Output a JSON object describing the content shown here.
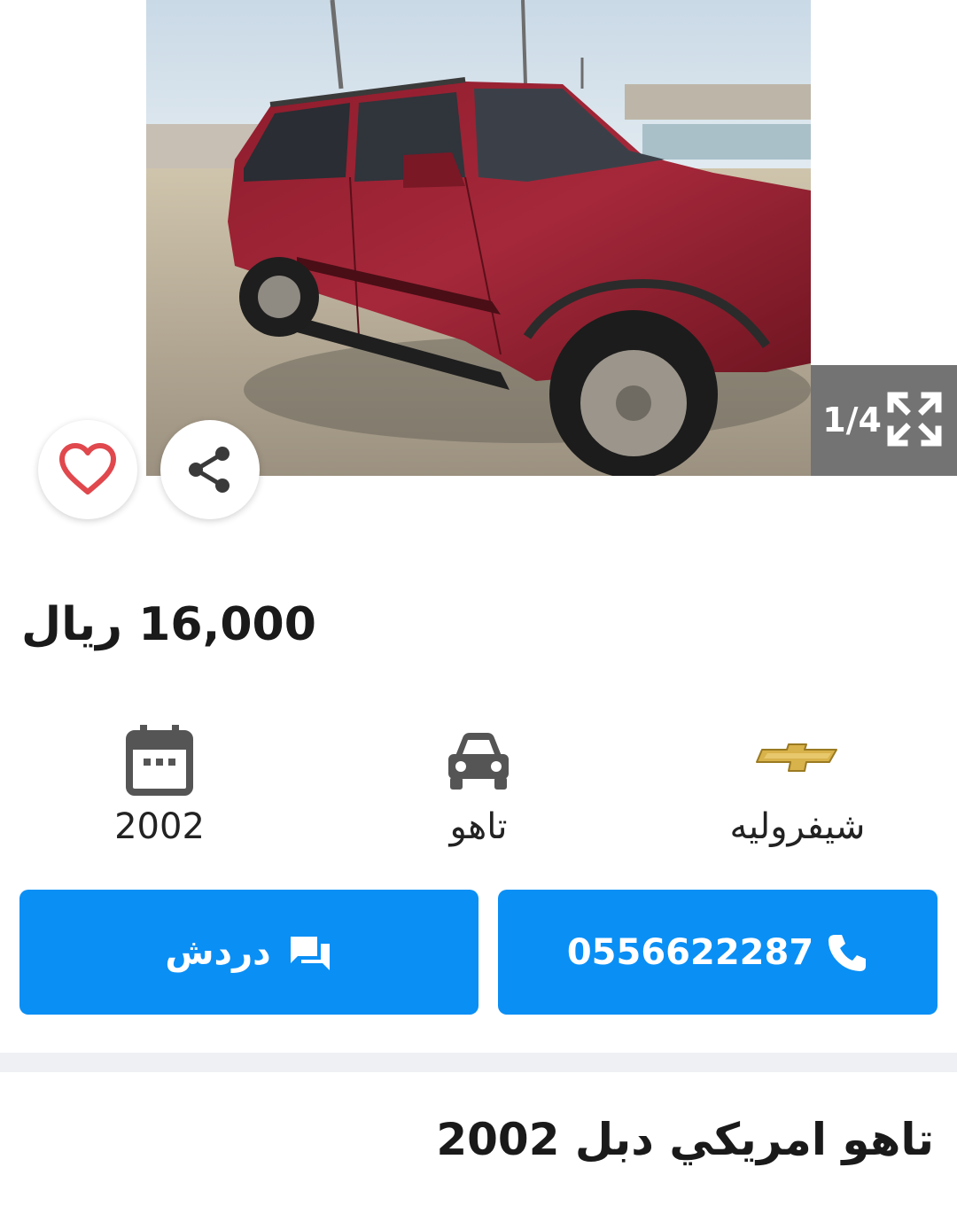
{
  "gallery": {
    "counter": "1/4",
    "current_image": 1,
    "total_images": 4,
    "image_subject": "red SUV parked on sand",
    "icons": {
      "prev": "chevron-left-icon",
      "next": "chevron-right-icon",
      "fullscreen": "expand-icon",
      "favorite": "heart-icon",
      "share": "share-icon"
    }
  },
  "listing": {
    "price": "16,000 ريال",
    "title": "تاهو امريكي دبل 2002"
  },
  "specs": {
    "make": "شيفروليه",
    "model": "تاهو",
    "year": "2002",
    "icons": {
      "make": "chevrolet-logo-icon",
      "model": "car-icon",
      "year": "calendar-icon"
    }
  },
  "actions": {
    "call_label": "0556622287",
    "chat_label": "دردش",
    "icons": {
      "call": "phone-icon",
      "chat": "chat-icon"
    }
  },
  "colors": {
    "accent": "#0a8ff5",
    "favorite": "#e0484d",
    "divider": "#eef0f3",
    "car_body": "#8e1c2c"
  }
}
